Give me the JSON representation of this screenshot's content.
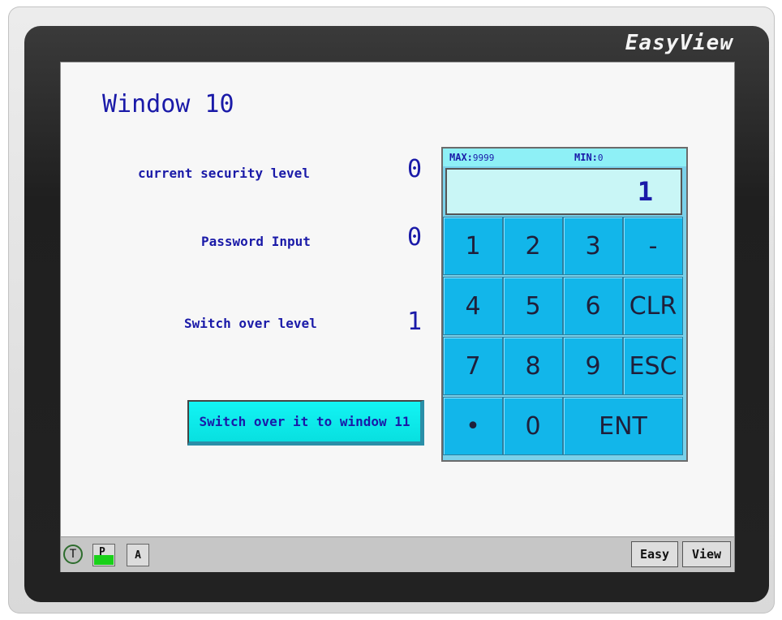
{
  "brand": "EasyView",
  "window_title": "Window 10",
  "fields": [
    {
      "label": "current security level",
      "value": "0"
    },
    {
      "label": "Password Input",
      "value": "0"
    },
    {
      "label": "Switch over level",
      "value": "1"
    }
  ],
  "switch_button_label": "Switch over it to window 11",
  "keypad": {
    "max_label": "MAX:",
    "max_value": "9999",
    "min_label": "MIN:",
    "min_value": "0",
    "display_value": "1",
    "keys": {
      "k1": "1",
      "k2": "2",
      "k3": "3",
      "minus": "-",
      "k4": "4",
      "k5": "5",
      "k6": "6",
      "clr": "CLR",
      "k7": "7",
      "k8": "8",
      "k9": "9",
      "esc": "ESC",
      "dot": "•",
      "k0": "0",
      "ent": "ENT"
    }
  },
  "taskbar": {
    "t": "T",
    "p": "P",
    "a": "A",
    "easy": "Easy",
    "view": "View"
  },
  "colors": {
    "label_text": "#1a1aa8",
    "key_blue": "#12b6ea",
    "switch_button": "#13f4f4",
    "p_indicator": "#19d119"
  }
}
